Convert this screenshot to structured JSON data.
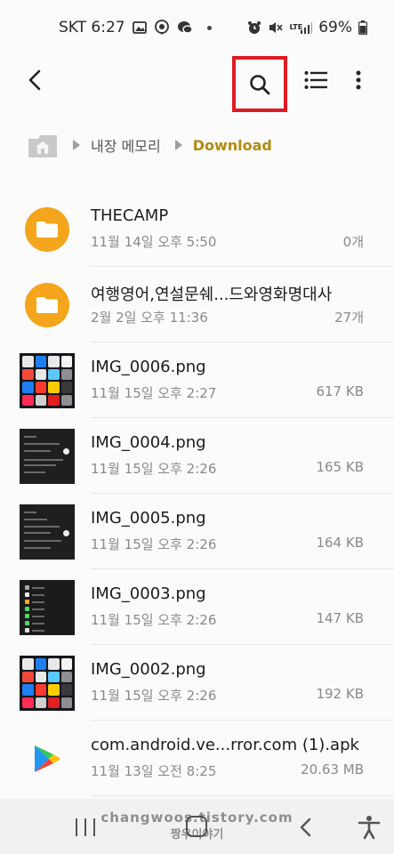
{
  "status_bar": {
    "carrier_time": "SKT 6:27",
    "lte": "LTE",
    "battery": "69%"
  },
  "toolbar": {
    "back": "back-arrow-icon",
    "search": "search-icon",
    "list_view": "list-view-icon",
    "more": "more-vert-icon",
    "highlight_color": "#e01a22"
  },
  "breadcrumb": {
    "home": "home-icon",
    "internal_storage": "내장 메모리",
    "current": "Download",
    "current_color": "#b48a10"
  },
  "files": [
    {
      "name": "THECAMP",
      "date": "11월 14일 오후 5:50",
      "size": "0개",
      "type": "folder"
    },
    {
      "name": "여행영어,연설문쉐...드와영화명대사",
      "date": "2월 2일 오후 11:36",
      "size": "27개",
      "type": "folder"
    },
    {
      "name": "IMG_0006.png",
      "date": "11월 15일 오후 2:27",
      "size": "617 KB",
      "type": "ios-homescreen"
    },
    {
      "name": "IMG_0004.png",
      "date": "11월 15일 오후 2:26",
      "size": "165 KB",
      "type": "dark-settings"
    },
    {
      "name": "IMG_0005.png",
      "date": "11월 15일 오후 2:26",
      "size": "164 KB",
      "type": "dark-settings"
    },
    {
      "name": "IMG_0003.png",
      "date": "11월 15일 오후 2:26",
      "size": "147 KB",
      "type": "dark-list"
    },
    {
      "name": "IMG_0002.png",
      "date": "11월 15일 오후 2:26",
      "size": "192 KB",
      "type": "ios-homescreen"
    },
    {
      "name": "com.android.ve...rror.com (1).apk",
      "date": "11월 13일 오전 8:25",
      "size": "20.63 MB",
      "type": "apk"
    }
  ],
  "navbar": {
    "recents": "recents-icon",
    "home": "home-button-icon",
    "back": "back-icon",
    "accessibility": "accessibility-icon"
  },
  "watermark": {
    "line1": "changwoos.tistory.com",
    "line2": "짱우이야기"
  }
}
